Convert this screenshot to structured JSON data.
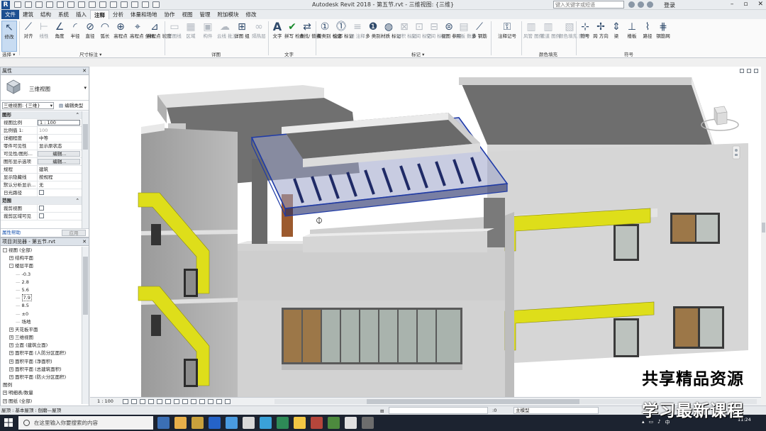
{
  "titlebar": {
    "app_title": "Autodesk Revit 2018 -",
    "doc_title": "第五节.rvt - 三维视图: {三维}",
    "search_placeholder": "键入关键字或短语",
    "login": "登录"
  },
  "tabs": [
    "文件",
    "建筑",
    "结构",
    "系统",
    "插入",
    "注释",
    "分析",
    "体量和场地",
    "协作",
    "视图",
    "管理",
    "附加模块",
    "修改"
  ],
  "ribbon": {
    "modify": "修改",
    "select_label": "选择 ▾",
    "dimension_label": "尺寸标注 ▾",
    "detail_label": "详图",
    "text_label": "文字",
    "tag_label": "标记 ▾",
    "color_fill_label": "颜色填充",
    "symbol_label": "符号",
    "tools": [
      {
        "label": "对齐"
      },
      {
        "label": "线性"
      },
      {
        "label": "角度"
      },
      {
        "label": "半径"
      },
      {
        "label": "直径"
      },
      {
        "label": "弧长"
      },
      {
        "label": "高程点"
      },
      {
        "label": "高程点 坐标"
      },
      {
        "label": "高程点 坡度"
      },
      {
        "label": "详图线"
      },
      {
        "label": "区域"
      },
      {
        "label": "构件"
      },
      {
        "label": "云线 批注"
      },
      {
        "label": "详图 组"
      },
      {
        "label": "隔热层"
      },
      {
        "label": "文字"
      },
      {
        "label": "拼写 检查"
      },
      {
        "label": "查找/ 替换"
      },
      {
        "label": "按类别 标记"
      },
      {
        "label": "全部 标记"
      },
      {
        "label": "梁 注释"
      },
      {
        "label": "多 类别"
      },
      {
        "label": "材质 标记"
      },
      {
        "label": "面积 标记"
      },
      {
        "label": "房间 标记"
      },
      {
        "label": "空间 标记"
      },
      {
        "label": "视图 参照"
      },
      {
        "label": "踏板 数量"
      },
      {
        "label": "多 钢筋"
      },
      {
        "label": "注释记号"
      },
      {
        "label": "风管 图例"
      },
      {
        "label": "管道 图例"
      },
      {
        "label": "颜色填充 图例"
      },
      {
        "label": "符号"
      },
      {
        "label": "跨 方向"
      },
      {
        "label": "梁"
      },
      {
        "label": "楼板"
      },
      {
        "label": "路径"
      },
      {
        "label": "钢筋网"
      }
    ]
  },
  "properties": {
    "title": "属性",
    "type_name": "三维视图",
    "instance": "三维视图: {三维}",
    "edit_type": "编辑类型",
    "category_graphics": "图形",
    "category_range": "范围",
    "rows": [
      {
        "k": "视图比例",
        "v": "1 : 100"
      },
      {
        "k": "比例值 1:",
        "v": "100"
      },
      {
        "k": "详细程度",
        "v": "中等"
      },
      {
        "k": "零件可见性",
        "v": "显示原状态"
      },
      {
        "k": "可见性/图形...",
        "v": "编辑..."
      },
      {
        "k": "图形显示选项",
        "v": "编辑..."
      },
      {
        "k": "规程",
        "v": "建筑"
      },
      {
        "k": "显示隐藏线",
        "v": "按规程"
      },
      {
        "k": "默认分析显示...",
        "v": "无"
      },
      {
        "k": "日光路径",
        "v": ""
      }
    ],
    "range_rows": [
      {
        "k": "裁剪视图",
        "v": ""
      },
      {
        "k": "裁剪区域可见",
        "v": ""
      }
    ],
    "help_link": "属性帮助",
    "apply": "应用"
  },
  "browser": {
    "title": "项目浏览器 - 第五节.rvt",
    "items": [
      {
        "t": "视图 (全部)",
        "lvl": 0,
        "tog": "-"
      },
      {
        "t": "结构平面",
        "lvl": 1,
        "tog": "+"
      },
      {
        "t": "楼层平面",
        "lvl": 1,
        "tog": "-"
      },
      {
        "t": "-0.3",
        "lvl": 2
      },
      {
        "t": "2.8",
        "lvl": 2
      },
      {
        "t": "5.6",
        "lvl": 2
      },
      {
        "t": "7.9",
        "lvl": 2,
        "sel": true
      },
      {
        "t": "8.5",
        "lvl": 2
      },
      {
        "t": "±0",
        "lvl": 2
      },
      {
        "t": "场地",
        "lvl": 2
      },
      {
        "t": "天花板平面",
        "lvl": 1,
        "tog": "+"
      },
      {
        "t": "三维视图",
        "lvl": 1,
        "tog": "+"
      },
      {
        "t": "立面 (建筑立面)",
        "lvl": 1,
        "tog": "+"
      },
      {
        "t": "面积平面 (人防分区面积)",
        "lvl": 1,
        "tog": "+"
      },
      {
        "t": "面积平面 (净面积)",
        "lvl": 1,
        "tog": "+"
      },
      {
        "t": "面积平面 (总建筑面积)",
        "lvl": 1,
        "tog": "+"
      },
      {
        "t": "面积平面 (防火分区面积)",
        "lvl": 1,
        "tog": "+"
      },
      {
        "t": "图例",
        "lvl": 0
      },
      {
        "t": "明细表/数量",
        "lvl": 0,
        "tog": "+"
      },
      {
        "t": "图纸 (全部)",
        "lvl": 0,
        "tog": "+"
      }
    ]
  },
  "viewbar": {
    "scale": "1 : 100"
  },
  "statusbar": {
    "message": "屋顶 : 基本屋顶 : 刨磨—屋顶",
    "coord": ":0",
    "model": "主模型"
  },
  "taskbar": {
    "search_placeholder": "在这里输入你要搜索的内容",
    "tray_lang": "中",
    "clock": "11:24"
  },
  "watermark": {
    "line1": "共享精品资源",
    "line2": "学习最新课程"
  },
  "colors": {
    "accent": "#1d4f91",
    "yellow_trim": "#dede1a",
    "selection": "#1f3ba8"
  }
}
